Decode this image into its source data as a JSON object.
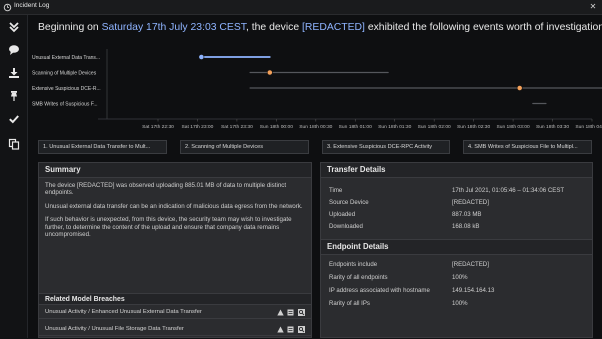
{
  "window": {
    "title": "Incident Log"
  },
  "heading": {
    "prefix": "Beginning on ",
    "date": "Saturday 17th July 23:03 CEST",
    "middle": ", the device ",
    "device": "[REDACTED]",
    "suffix": " exhibited the following events worth of investigation"
  },
  "chart_data": {
    "type": "timeline",
    "events": [
      {
        "label": "Unusual External Data Trans...",
        "start": "Sat 17th 23:03",
        "end": "Sat 17th 23:55",
        "point": "Sat 17th 23:03",
        "color": "#8fb4ff"
      },
      {
        "label": "Scanning of Multiple Devices",
        "start": "Sat 17th 23:40",
        "end": "Sun 18th 01:25",
        "point": "Sat 17th 23:55",
        "color": "#f4a15a"
      },
      {
        "label": "Extensive Suspicious DCE-R...",
        "start": "Sat 17th 23:40",
        "end": "Sun 18th 04:20",
        "point": "Sun 18th 03:05",
        "color": "#f4a15a"
      },
      {
        "label": "SMB Writes of Suspicious F...",
        "start": "Sun 18th 03:15",
        "end": "Sun 18th 03:25",
        "point": "Sun 18th 06:15",
        "color": "#f4a15a"
      }
    ],
    "x_ticks": [
      "Sat 17th 22:30",
      "Sat 17th 23:00",
      "Sat 17th 23:30",
      "Sun 18th 00:00",
      "Sun 18th 00:30",
      "Sun 18th 01:00",
      "Sun 18th 01:30",
      "Sun 18th 02:00",
      "Sun 18th 02:30",
      "Sun 18th 03:00",
      "Sun 18th 03:30",
      "Sun 18th 04:00"
    ]
  },
  "tabs": [
    "1. Unusual External Data Transfer to Mult...",
    "2. Scanning of Multiple Devices",
    "3. Extensive Suspicious DCE-RPC Activity",
    "4. SMB Writes of Suspicious File to Multipl..."
  ],
  "summary": {
    "title": "Summary",
    "paragraphs": [
      "The device [REDACTED] was observed uploading 885.01 MB of data to multiple distinct endpoints.",
      "Unusual external data transfer can be an indication of malicious data egress from the network.",
      "If such behavior is unexpected, from this device, the security team may wish to investigate further, to determine the content of the upload and ensure that company data remains uncompromised."
    ]
  },
  "breaches": {
    "title": "Related Model Breaches",
    "items": [
      "Unusual Activity / Enhanced Unusual External Data Transfer",
      "Unusual Activity / Unusual File Storage Data Transfer"
    ]
  },
  "transfer": {
    "title": "Transfer Details",
    "rows": [
      {
        "key": "Time",
        "value": "17th Jul 2021, 01:05:46 – 01:34:06 CEST"
      },
      {
        "key": "Source Device",
        "value": "[REDACTED]"
      },
      {
        "key": "Uploaded",
        "value": "887.03 MB"
      },
      {
        "key": "Downloaded",
        "value": "168.08 kB"
      }
    ]
  },
  "endpoint": {
    "title": "Endpoint Details",
    "rows": [
      {
        "key": "Endpoints include",
        "value": "[REDACTED]"
      },
      {
        "key": "Rarity of all endpoints",
        "value": "100%"
      },
      {
        "key": "IP address associated with hostname",
        "value": "149.154.164.13"
      },
      {
        "key": "Rarity of all IPs",
        "value": "100%"
      }
    ]
  },
  "colors": {
    "accent": "#8fb4ff",
    "event_marker": "#f4a15a"
  }
}
